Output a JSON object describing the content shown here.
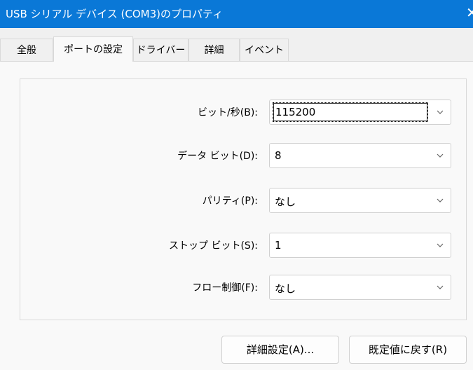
{
  "window": {
    "title": "USB シリアル デバイス (COM3)のプロパティ",
    "close_glyph": "✕"
  },
  "tabs": [
    {
      "label": "全般"
    },
    {
      "label": "ポートの設定"
    },
    {
      "label": "ドライバー"
    },
    {
      "label": "詳細"
    },
    {
      "label": "イベント"
    }
  ],
  "active_tab": "ポートの設定",
  "settings": {
    "bits_per_second": {
      "label": "ビット/秒(B):",
      "value": "115200"
    },
    "data_bits": {
      "label": "データ ビット(D):",
      "value": "8"
    },
    "parity": {
      "label": "パリティ(P):",
      "value": "なし"
    },
    "stop_bits": {
      "label": "ストップ ビット(S):",
      "value": "1"
    },
    "flow_control": {
      "label": "フロー制御(F):",
      "value": "なし"
    }
  },
  "buttons": {
    "advanced": "詳細設定(A)...",
    "restore_defaults": "既定値に戻す(R)"
  },
  "colors": {
    "titlebar": "#0a78d7",
    "panel": "#f9f9f9",
    "window_bg": "#f0f0f0"
  }
}
